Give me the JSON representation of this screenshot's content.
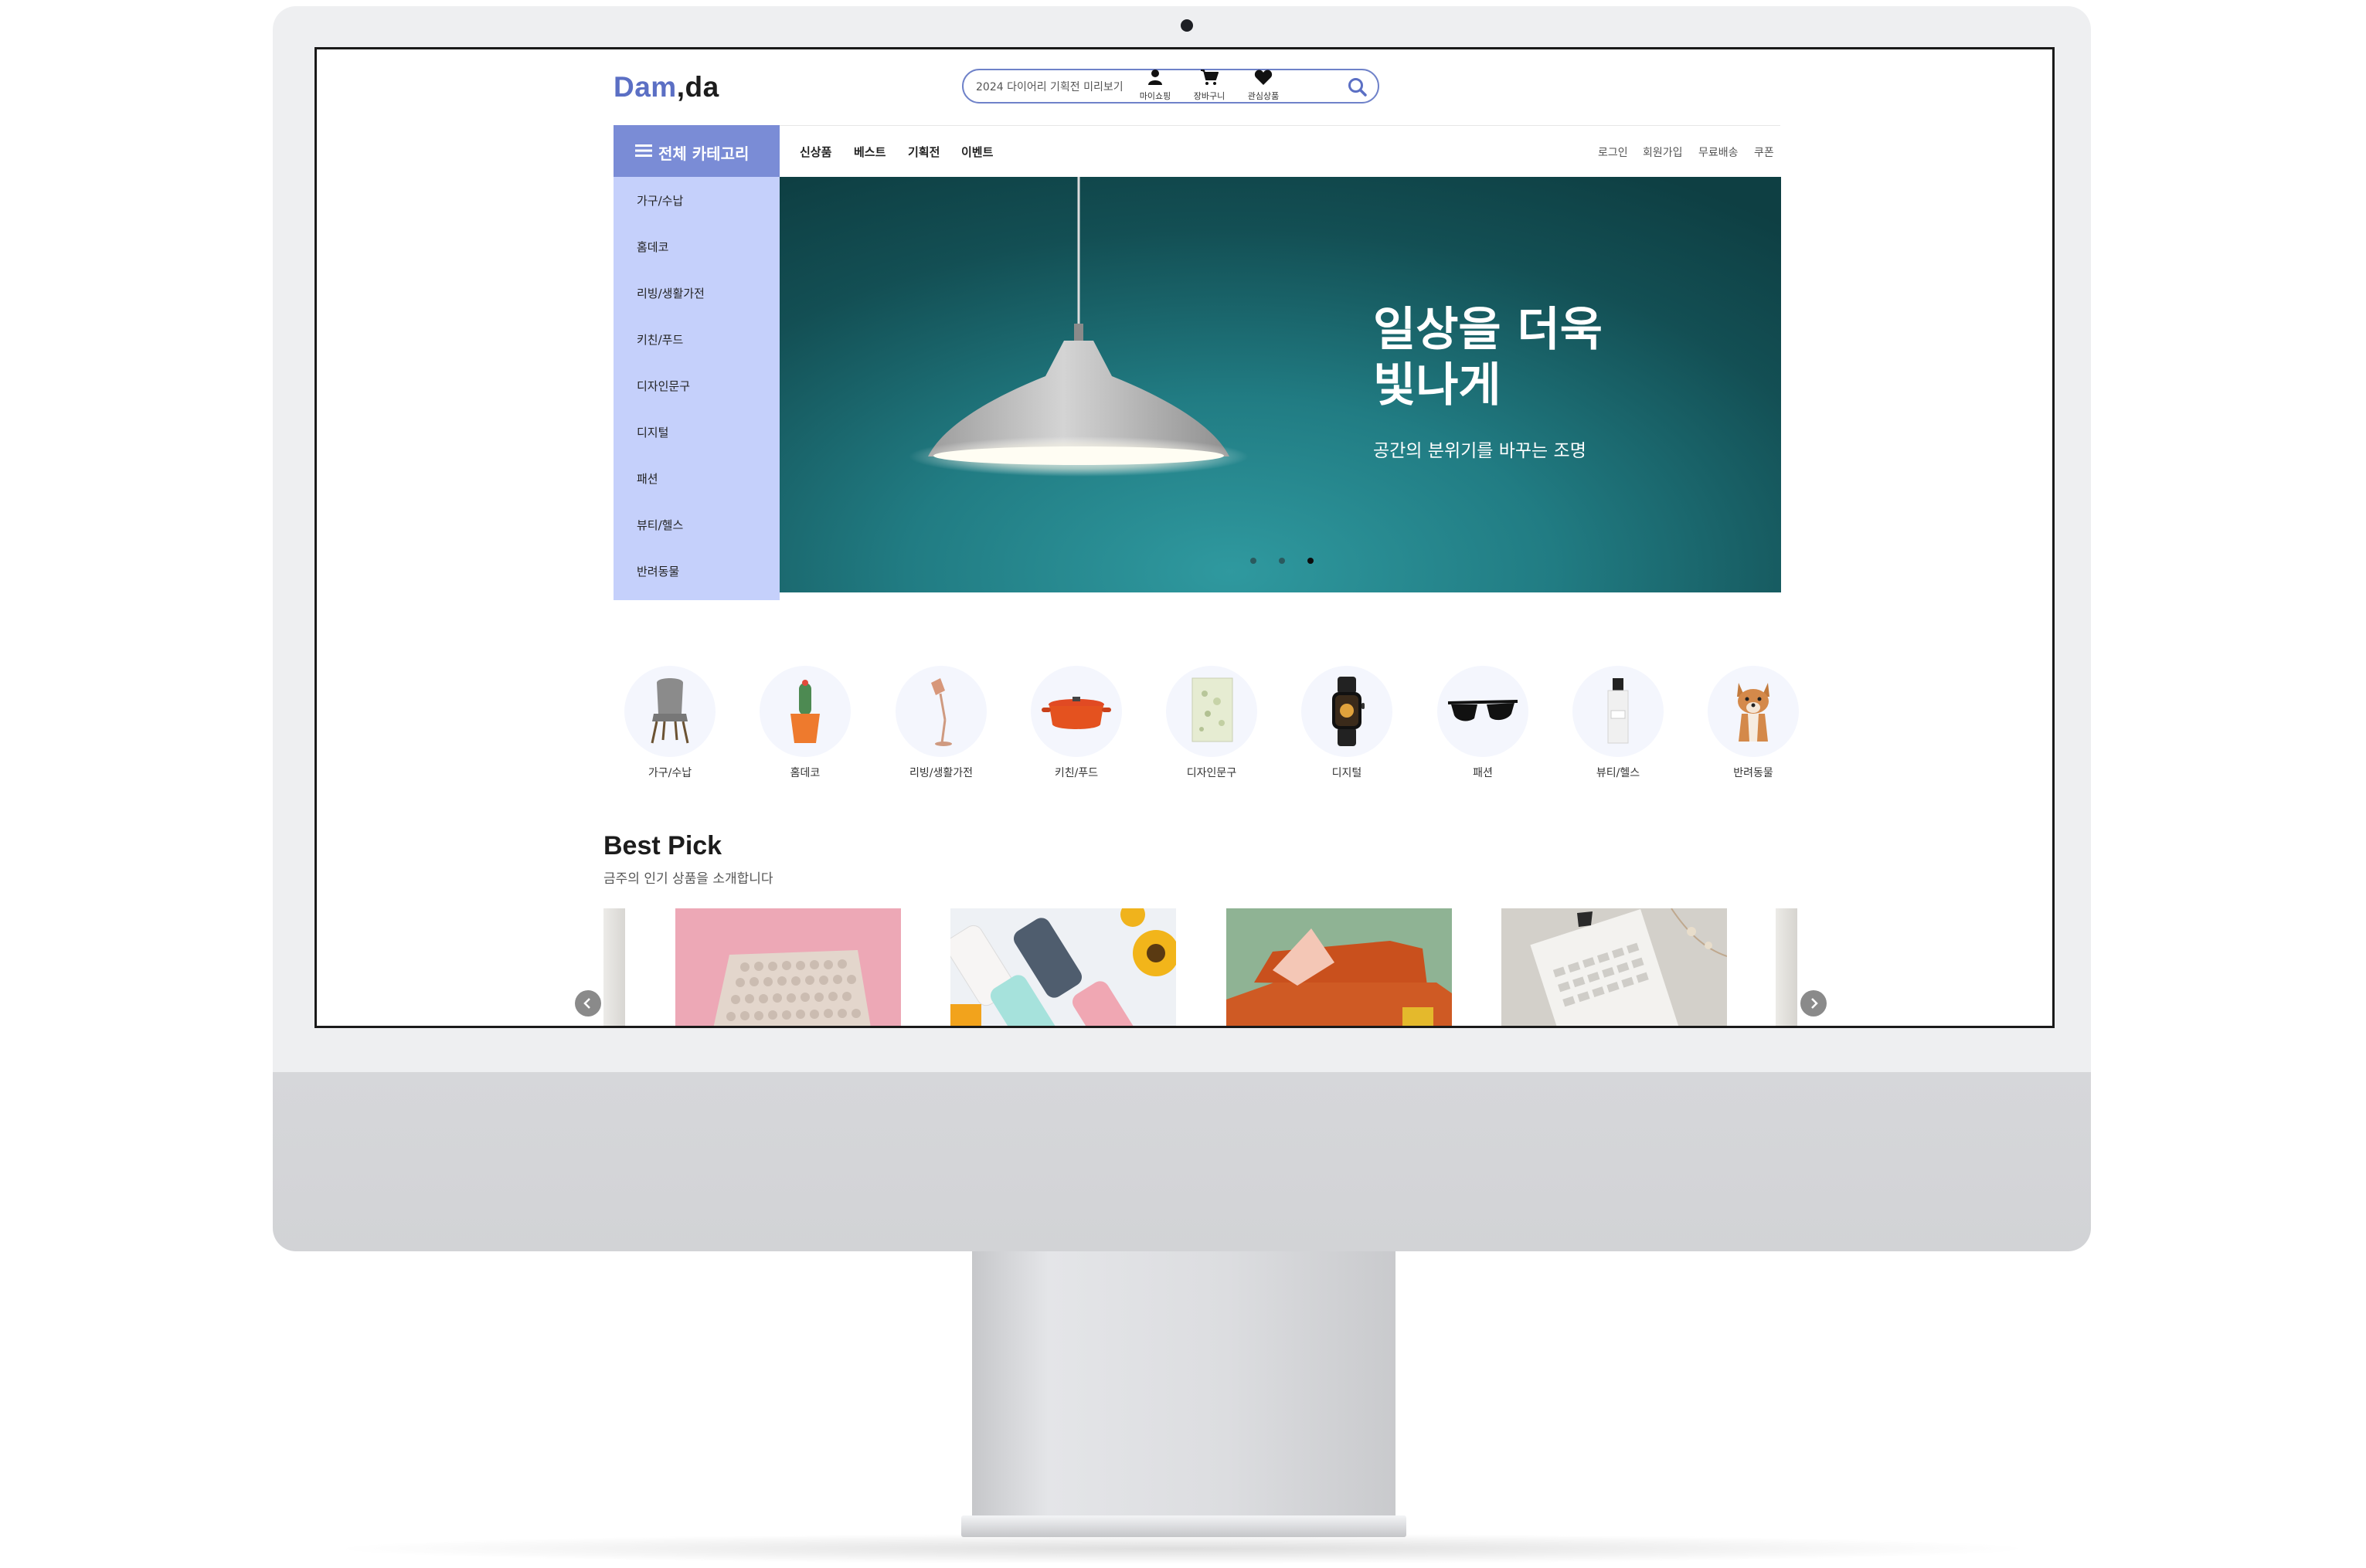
{
  "header": {
    "logo_part1": "Dam",
    "logo_part2": ",da",
    "search_placeholder": "2024 다이어리 기획전 미리보기",
    "icons": [
      {
        "name": "user-icon",
        "label": "마이쇼핑"
      },
      {
        "name": "cart-icon",
        "label": "장바구니"
      },
      {
        "name": "heart-icon",
        "label": "관심상품"
      }
    ]
  },
  "nav": {
    "category_toggle": "전체 카테고리",
    "links": [
      "신상품",
      "베스트",
      "기획전",
      "이벤트"
    ],
    "utility_links": [
      "로그인",
      "회원가입",
      "무료배송",
      "쿠폰"
    ]
  },
  "category_menu": [
    "가구/수납",
    "홈데코",
    "리빙/생활가전",
    "키친/푸드",
    "디자인문구",
    "디지털",
    "패션",
    "뷰티/헬스",
    "반려동물"
  ],
  "hero": {
    "title": "일상을 더욱\n빛나게",
    "subtitle": "공간의 분위기를 바꾸는 조명",
    "slide_count": 3,
    "active_slide": 3
  },
  "quick_categories": [
    {
      "label": "가구/수납",
      "icon": "chair-icon"
    },
    {
      "label": "홈데코",
      "icon": "cactus-icon"
    },
    {
      "label": "리빙/생활가전",
      "icon": "lamp-icon"
    },
    {
      "label": "키친/푸드",
      "icon": "pot-icon"
    },
    {
      "label": "디자인문구",
      "icon": "notebook-icon"
    },
    {
      "label": "디지털",
      "icon": "watch-icon"
    },
    {
      "label": "패션",
      "icon": "sunglasses-icon"
    },
    {
      "label": "뷰티/헬스",
      "icon": "perfume-icon"
    },
    {
      "label": "반려동물",
      "icon": "dog-icon"
    }
  ],
  "best_pick": {
    "title": "Best Pick",
    "subtitle": "금주의 인기 상품을 소개합니다",
    "products": [
      {
        "image": "keyboard-image"
      },
      {
        "image": "phone-cases-image"
      },
      {
        "image": "sofa-image"
      },
      {
        "image": "calendar-image"
      }
    ],
    "prev_icon": "chevron-left-icon",
    "next_icon": "chevron-right-icon"
  },
  "colors": {
    "accent": "#7a8cd6",
    "logo_blue": "#5b6fc4",
    "category_menu_bg": "#c5d0fb",
    "hero_teal": "#217c83"
  }
}
